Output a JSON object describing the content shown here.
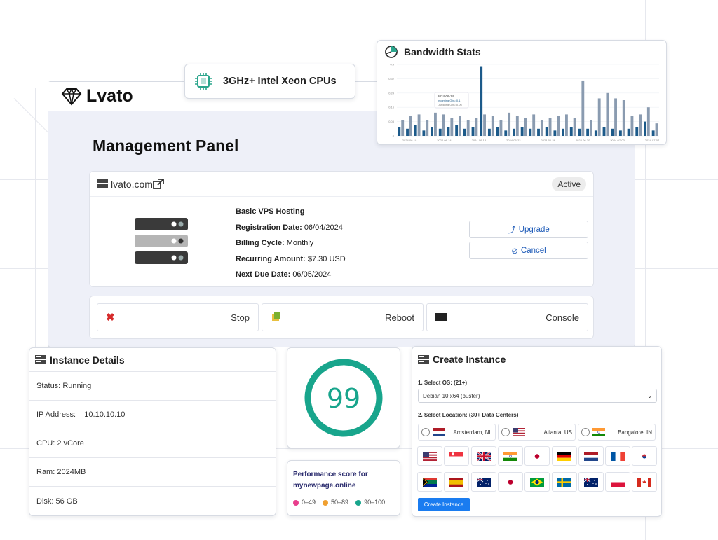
{
  "brand": {
    "name": "Lvato"
  },
  "cpu_card": {
    "label": "3GHz+ Intel Xeon CPUs"
  },
  "bandwidth": {
    "title": "Bandwidth Stats",
    "tooltip": {
      "date": "2024-06-14",
      "incoming": "Incoming Gbs: 0.1",
      "outgoing": "Outgoing Gbs: 0.06"
    }
  },
  "chart_data": {
    "type": "bar",
    "title": "Bandwidth Stats",
    "y_ticks": [
      "0",
      "0.08",
      "0.16",
      "0.24",
      "0.32",
      "0.4"
    ],
    "x_ticks": [
      "2024-06-10",
      "2024-06-14",
      "2024-06-18",
      "2024-06-22",
      "2024-06-26",
      "2024-06-30",
      "2024-07-03",
      "2024-07-07"
    ],
    "ylim": [
      0,
      0.4
    ],
    "series": [
      {
        "values": [
          0.05,
          0.04,
          0.06,
          0.03,
          0.05,
          0.04,
          0.05,
          0.06,
          0.04,
          0.05,
          0.39,
          0.04,
          0.05,
          0.03,
          0.04,
          0.05,
          0.04,
          0.04,
          0.05,
          0.03,
          0.04,
          0.05,
          0.04,
          0.04,
          0.03,
          0.05,
          0.04,
          0.03,
          0.04,
          0.05,
          0.08,
          0.03
        ]
      },
      {
        "values": [
          0.09,
          0.11,
          0.12,
          0.09,
          0.13,
          0.12,
          0.1,
          0.11,
          0.09,
          0.1,
          0.12,
          0.11,
          0.09,
          0.13,
          0.11,
          0.1,
          0.12,
          0.09,
          0.1,
          0.11,
          0.12,
          0.1,
          0.31,
          0.09,
          0.21,
          0.24,
          0.21,
          0.2,
          0.11,
          0.12,
          0.16,
          0.07
        ]
      }
    ],
    "colors": [
      "#1c5a8a",
      "#8a9bb0"
    ]
  },
  "main": {
    "title": "Management Panel",
    "service": {
      "domain": "lvato.com",
      "status": "Active",
      "plan": "Basic VPS Hosting",
      "rows": [
        {
          "label": "Registration Date:",
          "value": "06/04/2024"
        },
        {
          "label": "Billing Cycle:",
          "value": "Monthly"
        },
        {
          "label": "Recurring Amount:",
          "value": "$7.30 USD"
        },
        {
          "label": "Next Due Date:",
          "value": "06/05/2024"
        }
      ],
      "upgrade_label": "Upgrade",
      "cancel_label": "Cancel"
    },
    "power": {
      "stop": "Stop",
      "reboot": "Reboot",
      "console": "Console"
    }
  },
  "instance_details": {
    "title": "Instance Details",
    "rows": [
      {
        "label": "Status:",
        "value": "Running"
      },
      {
        "label": "IP Address:",
        "value": "10.10.10.10"
      },
      {
        "label": "CPU:",
        "value": "2 vCore"
      },
      {
        "label": "Ram:",
        "value": "2024MB"
      },
      {
        "label": "Disk:",
        "value": "56 GB"
      }
    ]
  },
  "performance": {
    "score": "99",
    "score_value": 0.99,
    "caption_line1": "Performance score for",
    "caption_line2": "mynewpage.online",
    "legend": [
      "0–49",
      "50–89",
      "90–100"
    ],
    "legend_colors": [
      "#e83e8c",
      "#f0a030",
      "#18a58c"
    ]
  },
  "create_instance": {
    "title": "Create Instance",
    "os_label": "1. Select OS: (21+)",
    "os_value": "Debian 10 x64 (buster)",
    "location_label": "2. Select Location: (30+ Data Centers)",
    "locations": [
      "Amsterdam, NL",
      "Atlanta, US",
      "Bangalore, IN"
    ],
    "button_label": "Create Instance"
  }
}
